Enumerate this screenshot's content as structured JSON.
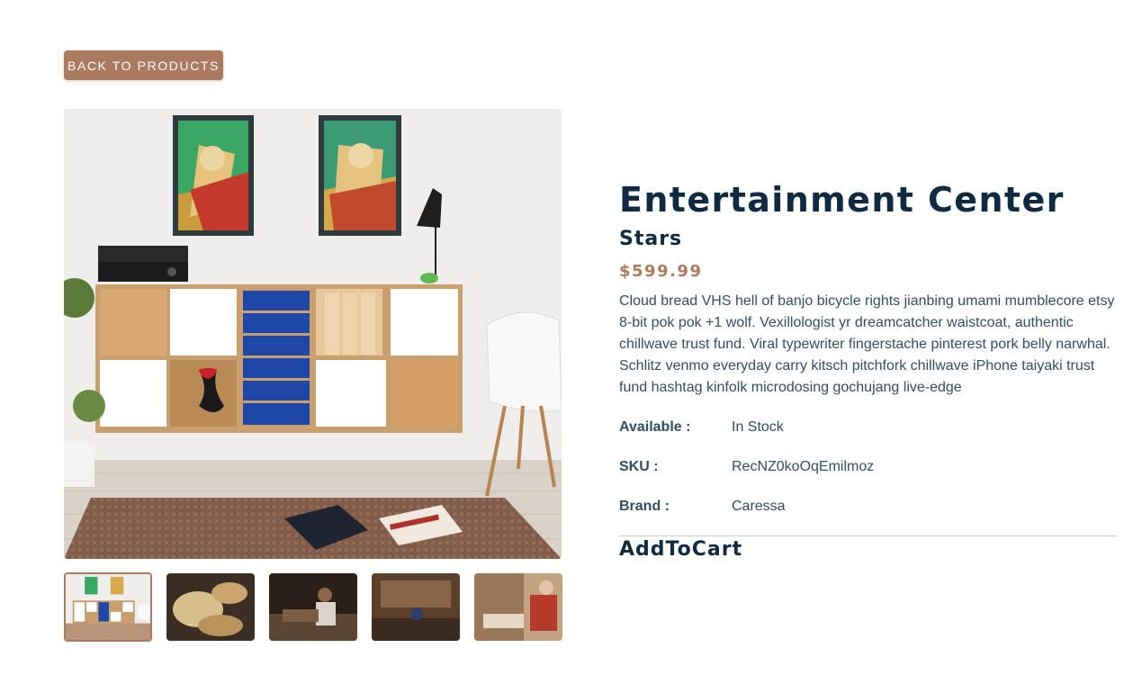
{
  "back_button": {
    "label": "BACK TO PRODUCTS"
  },
  "product": {
    "title": "Entertainment Center",
    "company": "Stars",
    "price": "$599.99",
    "description": "Cloud bread VHS hell of banjo bicycle rights jianbing umami mumblecore etsy 8-bit pok pok +1 wolf. Vexillologist yr dreamcatcher waistcoat, authentic chillwave trust fund. Viral typewriter fingerstache pinterest pork belly narwhal. Schlitz venmo everyday carry kitsch pitchfork chillwave iPhone taiyaki trust fund hashtag kinfolk microdosing gochujang live-edge",
    "details": [
      {
        "label": "Available :",
        "value": "In Stock"
      },
      {
        "label": "SKU :",
        "value": "RecNZ0koOqEmilmoz"
      },
      {
        "label": "Brand :",
        "value": "Caressa"
      }
    ],
    "add_to_cart": "AddToCart"
  },
  "gallery": {
    "main_image_icon": "living-room-shelf-photo",
    "thumbnails": [
      {
        "icon": "living-room-shelf-photo",
        "active": true
      },
      {
        "icon": "wood-shavings-photo",
        "active": false
      },
      {
        "icon": "woodworker-photo",
        "active": false
      },
      {
        "icon": "workshop-photo",
        "active": false
      },
      {
        "icon": "carpenter-photo",
        "active": false
      }
    ]
  },
  "colors": {
    "accent": "#ab7a5f",
    "heading": "#102a42",
    "body_text": "#324d67",
    "divider": "#bcccdc"
  }
}
